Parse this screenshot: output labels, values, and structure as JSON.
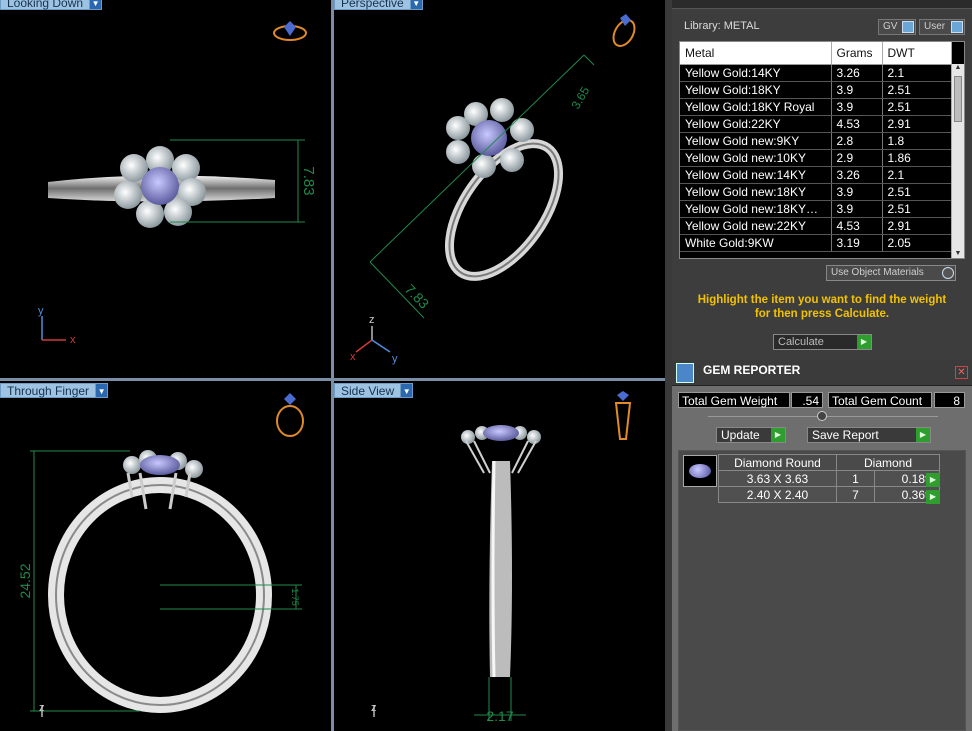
{
  "viewports": [
    {
      "label": "Looking Down",
      "dimension": "7.83",
      "axes": [
        "y",
        "x"
      ]
    },
    {
      "label": "Perspective",
      "dimension_a": "7.83",
      "dimension_b": "3.65",
      "axes": [
        "z",
        "x",
        "y"
      ]
    },
    {
      "label": "Through Finger",
      "dimension_a": "24.52",
      "dimension_b": "1.75",
      "axes": [
        "z"
      ]
    },
    {
      "label": "Side View",
      "dimension": "2.17",
      "axes": [
        "z"
      ]
    }
  ],
  "library": {
    "title": "Library: METAL",
    "gv_label": "GV",
    "user_label": "User",
    "columns": [
      "Metal",
      "Grams",
      "DWT"
    ],
    "rows": [
      [
        "Yellow Gold:14KY",
        "3.26",
        "2.1"
      ],
      [
        "Yellow Gold:18KY",
        "3.9",
        "2.51"
      ],
      [
        "Yellow Gold:18KY Royal",
        "3.9",
        "2.51"
      ],
      [
        "Yellow Gold:22KY",
        "4.53",
        "2.91"
      ],
      [
        "Yellow Gold new:9KY",
        "2.8",
        "1.8"
      ],
      [
        "Yellow Gold new:10KY",
        "2.9",
        "1.86"
      ],
      [
        "Yellow Gold new:14KY",
        "3.26",
        "2.1"
      ],
      [
        "Yellow Gold new:18KY",
        "3.9",
        "2.51"
      ],
      [
        "Yellow Gold new:18KY…",
        "3.9",
        "2.51"
      ],
      [
        "Yellow Gold new:22KY",
        "4.53",
        "2.91"
      ],
      [
        "White Gold:9KW",
        "3.19",
        "2.05"
      ]
    ],
    "use_object_materials": "Use Object Materials",
    "hint": "Highlight the item you want to find the weight for then press Calculate.",
    "calculate_label": "Calculate"
  },
  "gem_reporter": {
    "title": "GEM REPORTER",
    "total_weight_label": "Total Gem Weight",
    "total_weight_value": ".54",
    "total_count_label": "Total Gem Count",
    "total_count_value": "8",
    "update_label": "Update",
    "save_report_label": "Save Report",
    "table_headers": [
      "Diamond Round",
      "Diamond"
    ],
    "rows": [
      {
        "size": "3.63 X 3.63",
        "count": "1",
        "weight": "0.18tw"
      },
      {
        "size": "2.40 X 2.40",
        "count": "7",
        "weight": "0.36tw"
      }
    ]
  },
  "colors": {
    "viewport_bg": "#000000",
    "tab_bg": "#9ec3e2",
    "dimension": "#1f8a4c",
    "accent_green": "#2f9e2f",
    "hint_text": "#f2c200"
  }
}
